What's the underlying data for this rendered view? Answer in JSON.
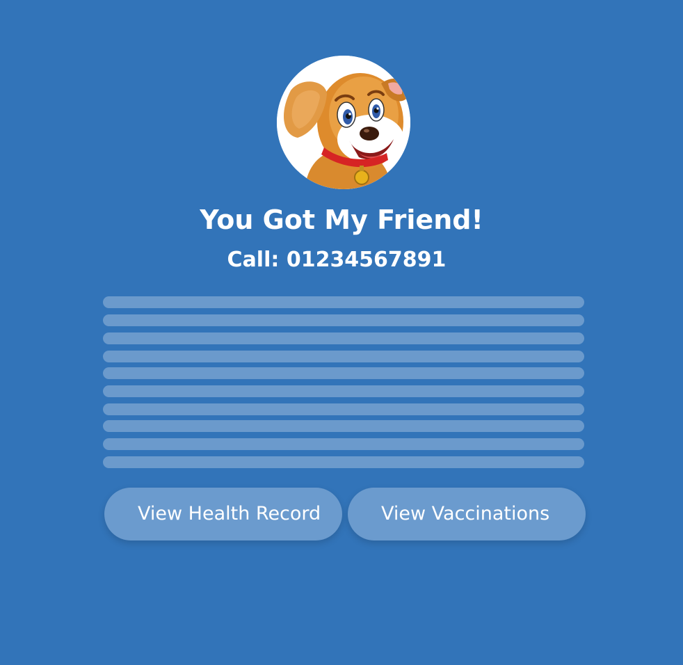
{
  "profile": {
    "avatar_icon": "dog-cartoon-icon",
    "title": "You Got My Friend!",
    "phone": "Call: 01234567891"
  },
  "content": {
    "placeholder_line_count": 10
  },
  "actions": {
    "health_label": "View Health Record",
    "vaccinations_label": "View Vaccinations"
  },
  "colors": {
    "background": "#3274b9",
    "button": "#6b9bce",
    "text": "#ffffff"
  }
}
